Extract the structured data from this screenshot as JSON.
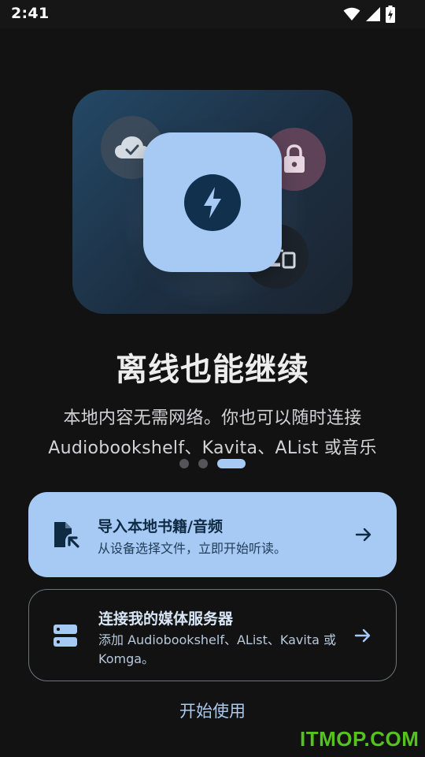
{
  "status_bar": {
    "time": "2:41",
    "icons": [
      "wifi-icon",
      "signal-icon",
      "battery-charging-icon"
    ]
  },
  "hero": {
    "icons": [
      "cloud-check-icon",
      "lock-icon",
      "devices-icon",
      "lightning-icon"
    ],
    "colors": {
      "card": "#a7caf5",
      "lock_bubble": "#5e4358",
      "background": "#244866"
    }
  },
  "onboarding": {
    "title": "离线也能继续",
    "description_line1": "本地内容无需网络。你也可以随时连接",
    "description_line2": "Audiobookshelf、Kavita、AList 或音乐",
    "page_count": 3,
    "active_page": 3
  },
  "actions": {
    "import": {
      "title": "导入本地书籍/音频",
      "subtitle": "从设备选择文件，立即开始听读。",
      "icon": "file-import-icon"
    },
    "connect": {
      "title": "连接我的媒体服务器",
      "subtitle": "添加 Audiobookshelf、AList、Kavita 或 Komga。",
      "icon": "server-icon"
    },
    "start_label": "开始使用"
  },
  "watermark": "ITMOP.COM",
  "theme": {
    "accent": "#a7caf5",
    "background": "#121212",
    "watermark": "#54c31e"
  }
}
